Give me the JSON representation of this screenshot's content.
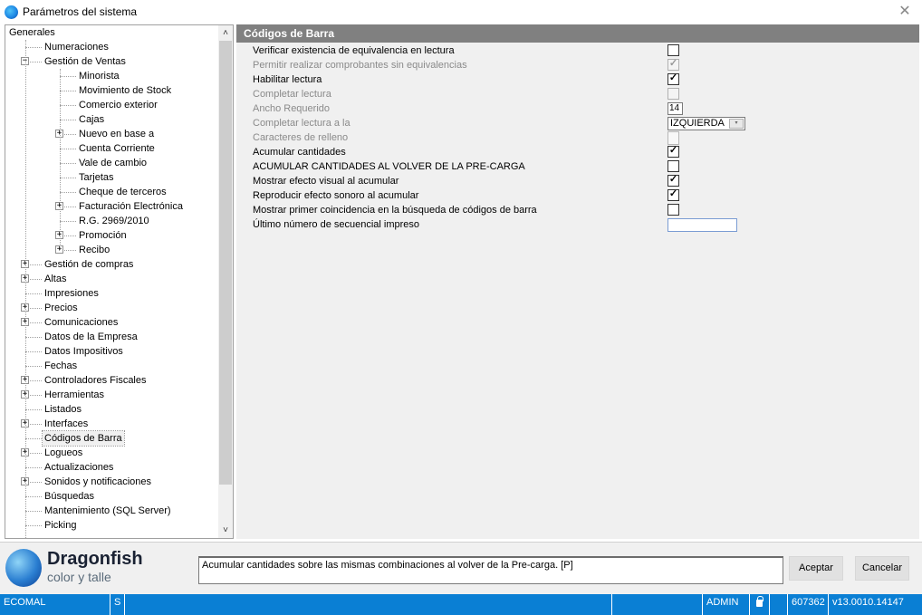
{
  "window": {
    "title": "Parámetros del sistema",
    "close_glyph": "✕"
  },
  "tree": {
    "items": [
      {
        "label": "Generales",
        "level": 0,
        "expander": "none"
      },
      {
        "label": "Numeraciones",
        "level": 1,
        "expander": "none"
      },
      {
        "label": "Gestión de Ventas",
        "level": 1,
        "expander": "minus"
      },
      {
        "label": "Minorista",
        "level": 2,
        "expander": "none"
      },
      {
        "label": "Movimiento de Stock",
        "level": 2,
        "expander": "none"
      },
      {
        "label": "Comercio exterior",
        "level": 2,
        "expander": "none"
      },
      {
        "label": "Cajas",
        "level": 2,
        "expander": "none"
      },
      {
        "label": "Nuevo en base a",
        "level": 2,
        "expander": "plus"
      },
      {
        "label": "Cuenta Corriente",
        "level": 2,
        "expander": "none"
      },
      {
        "label": "Vale de cambio",
        "level": 2,
        "expander": "none"
      },
      {
        "label": "Tarjetas",
        "level": 2,
        "expander": "none"
      },
      {
        "label": "Cheque de terceros",
        "level": 2,
        "expander": "none"
      },
      {
        "label": "Facturación Electrónica",
        "level": 2,
        "expander": "plus"
      },
      {
        "label": "R.G. 2969/2010",
        "level": 2,
        "expander": "none"
      },
      {
        "label": "Promoción",
        "level": 2,
        "expander": "plus"
      },
      {
        "label": "Recibo",
        "level": 2,
        "expander": "plus"
      },
      {
        "label": "Gestión de compras",
        "level": 1,
        "expander": "plus"
      },
      {
        "label": "Altas",
        "level": 1,
        "expander": "plus"
      },
      {
        "label": "Impresiones",
        "level": 1,
        "expander": "none"
      },
      {
        "label": "Precios",
        "level": 1,
        "expander": "plus"
      },
      {
        "label": "Comunicaciones",
        "level": 1,
        "expander": "plus"
      },
      {
        "label": "Datos de la Empresa",
        "level": 1,
        "expander": "none"
      },
      {
        "label": "Datos Impositivos",
        "level": 1,
        "expander": "none"
      },
      {
        "label": "Fechas",
        "level": 1,
        "expander": "none"
      },
      {
        "label": "Controladores Fiscales",
        "level": 1,
        "expander": "plus"
      },
      {
        "label": "Herramientas",
        "level": 1,
        "expander": "plus"
      },
      {
        "label": "Listados",
        "level": 1,
        "expander": "none"
      },
      {
        "label": "Interfaces",
        "level": 1,
        "expander": "plus"
      },
      {
        "label": "Códigos de Barra",
        "level": 1,
        "expander": "none",
        "selected": true
      },
      {
        "label": "Logueos",
        "level": 1,
        "expander": "plus"
      },
      {
        "label": "Actualizaciones",
        "level": 1,
        "expander": "none"
      },
      {
        "label": "Sonidos y notificaciones",
        "level": 1,
        "expander": "plus"
      },
      {
        "label": "Búsquedas",
        "level": 1,
        "expander": "none"
      },
      {
        "label": "Mantenimiento (SQL Server)",
        "level": 1,
        "expander": "none"
      },
      {
        "label": "Picking",
        "level": 1,
        "expander": "none"
      }
    ],
    "scroll_up_glyph": "˄",
    "scroll_down_glyph": "˅"
  },
  "section": {
    "title": "Códigos de Barra"
  },
  "params": [
    {
      "label": "Verificar existencia de equivalencia en lectura",
      "type": "checkbox",
      "checked": false,
      "disabled": false
    },
    {
      "label": "Permitir realizar comprobantes sin equivalencias",
      "type": "checkbox",
      "checked": true,
      "disabled": true
    },
    {
      "label": "Habilitar lectura",
      "type": "checkbox",
      "checked": true,
      "disabled": false
    },
    {
      "label": "Completar lectura",
      "type": "checkbox",
      "checked": false,
      "disabled": true
    },
    {
      "label": "Ancho Requerido",
      "type": "number",
      "value": "14",
      "disabled": true
    },
    {
      "label": "Completar lectura a la",
      "type": "combo",
      "value": "IZQUIERDA",
      "disabled": true
    },
    {
      "label": "Caracteres de relleno",
      "type": "textsmall",
      "value": "",
      "disabled": true
    },
    {
      "label": "Acumular cantidades",
      "type": "checkbox",
      "checked": true,
      "disabled": false
    },
    {
      "label": "ACUMULAR CANTIDADES AL VOLVER DE LA PRE-CARGA",
      "type": "checkbox",
      "checked": false,
      "disabled": false
    },
    {
      "label": "Mostrar efecto visual al acumular",
      "type": "checkbox",
      "checked": true,
      "disabled": false
    },
    {
      "label": "Reproducir efecto sonoro al acumular",
      "type": "checkbox",
      "checked": true,
      "disabled": false
    },
    {
      "label": "Mostrar primer coincidencia en la búsqueda de códigos de barra",
      "type": "checkbox",
      "checked": false,
      "disabled": false
    },
    {
      "label": "Último número de secuencial impreso",
      "type": "text",
      "value": "",
      "disabled": false
    }
  ],
  "check_glyph": "✓",
  "combo_arrow_glyph": "▾",
  "footer": {
    "brand_name": "Dragonfish",
    "brand_tagline": "color y talle",
    "description": "Acumular cantidades sobre las mismas combinaciones al volver de la Pre-carga. [P]",
    "accept_label": "Aceptar",
    "cancel_label": "Cancelar"
  },
  "statusbar": {
    "db": "ECOMAL",
    "mode": "S",
    "user": "ADMIN",
    "serial": "607362",
    "version": "v13.0010.14147"
  },
  "colors": {
    "statusbar_bg": "#0a7fd4",
    "section_header_bg": "#808080",
    "content_bg": "#f0f0f0"
  }
}
